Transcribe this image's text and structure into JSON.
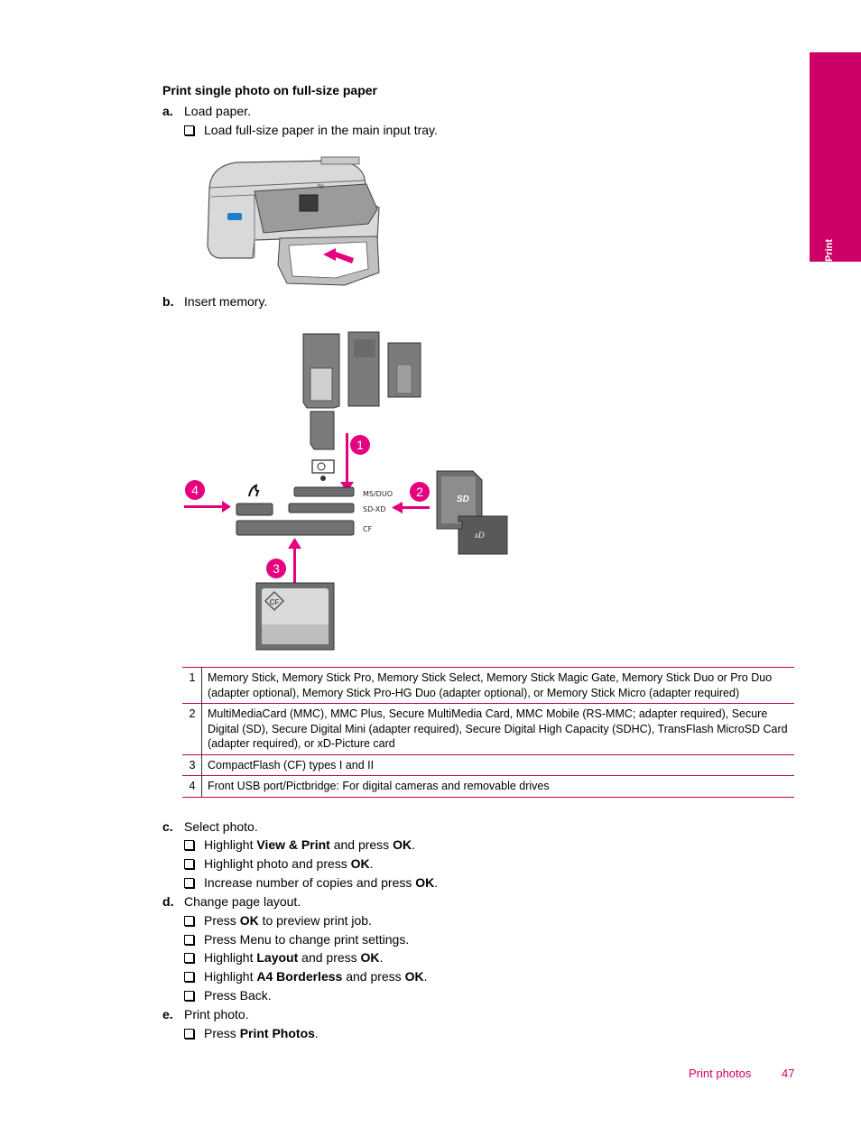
{
  "section_tab": {
    "label": "Print",
    "color": "#cc0066"
  },
  "heading": "Print single photo on full-size paper",
  "steps": [
    {
      "letter": "a",
      "text": "Load paper.",
      "substeps": [
        {
          "parts": [
            {
              "t": "Load full-size paper in the main input tray.",
              "b": false
            }
          ]
        }
      ]
    },
    {
      "letter": "b",
      "text": "Insert memory.",
      "substeps": []
    },
    {
      "letter": "c",
      "text": "Select photo.",
      "substeps": [
        {
          "parts": [
            {
              "t": "Highlight ",
              "b": false
            },
            {
              "t": "View & Print",
              "b": true
            },
            {
              "t": " and press ",
              "b": false
            },
            {
              "t": "OK",
              "b": true
            },
            {
              "t": ".",
              "b": false
            }
          ]
        },
        {
          "parts": [
            {
              "t": "Highlight photo and press ",
              "b": false
            },
            {
              "t": "OK",
              "b": true
            },
            {
              "t": ".",
              "b": false
            }
          ]
        },
        {
          "parts": [
            {
              "t": "Increase number of copies and press ",
              "b": false
            },
            {
              "t": "OK",
              "b": true
            },
            {
              "t": ".",
              "b": false
            }
          ]
        }
      ]
    },
    {
      "letter": "d",
      "text": "Change page layout.",
      "substeps": [
        {
          "parts": [
            {
              "t": "Press ",
              "b": false
            },
            {
              "t": "OK",
              "b": true
            },
            {
              "t": " to preview print job.",
              "b": false
            }
          ]
        },
        {
          "parts": [
            {
              "t": "Press Menu to change print settings.",
              "b": false
            }
          ]
        },
        {
          "parts": [
            {
              "t": "Highlight ",
              "b": false
            },
            {
              "t": "Layout",
              "b": true
            },
            {
              "t": " and press ",
              "b": false
            },
            {
              "t": "OK",
              "b": true
            },
            {
              "t": ".",
              "b": false
            }
          ]
        },
        {
          "parts": [
            {
              "t": "Highlight ",
              "b": false
            },
            {
              "t": "A4 Borderless",
              "b": true
            },
            {
              "t": " and press ",
              "b": false
            },
            {
              "t": "OK",
              "b": true
            },
            {
              "t": ".",
              "b": false
            }
          ]
        },
        {
          "parts": [
            {
              "t": "Press Back.",
              "b": false
            }
          ]
        }
      ]
    },
    {
      "letter": "e",
      "text": "Print photo.",
      "substeps": [
        {
          "parts": [
            {
              "t": "Press ",
              "b": false
            },
            {
              "t": "Print Photos",
              "b": true
            },
            {
              "t": ".",
              "b": false
            }
          ]
        }
      ]
    }
  ],
  "diagram": {
    "callouts": [
      "1",
      "2",
      "3",
      "4"
    ],
    "slot_labels": {
      "ms": "MS/DUO",
      "sd": "SD-XD",
      "cf": "CF"
    },
    "card_labels": {
      "sd": "SD",
      "xd": "xD",
      "cf": "CF"
    },
    "accent": "#e5007e"
  },
  "legend": [
    {
      "num": "1",
      "text": "Memory Stick, Memory Stick Pro, Memory Stick Select, Memory Stick Magic Gate, Memory Stick Duo or Pro Duo (adapter optional), Memory Stick Pro-HG Duo (adapter optional), or Memory Stick Micro (adapter required)"
    },
    {
      "num": "2",
      "text": "MultiMediaCard (MMC), MMC Plus, Secure MultiMedia Card, MMC Mobile (RS-MMC; adapter required), Secure Digital (SD), Secure Digital Mini (adapter required), Secure Digital High Capacity (SDHC), TransFlash MicroSD Card (adapter required), or xD-Picture card"
    },
    {
      "num": "3",
      "text": "CompactFlash (CF) types I and II"
    },
    {
      "num": "4",
      "text": "Front USB port/Pictbridge: For digital cameras and removable drives"
    }
  ],
  "footer": {
    "title": "Print photos",
    "page": "47"
  }
}
